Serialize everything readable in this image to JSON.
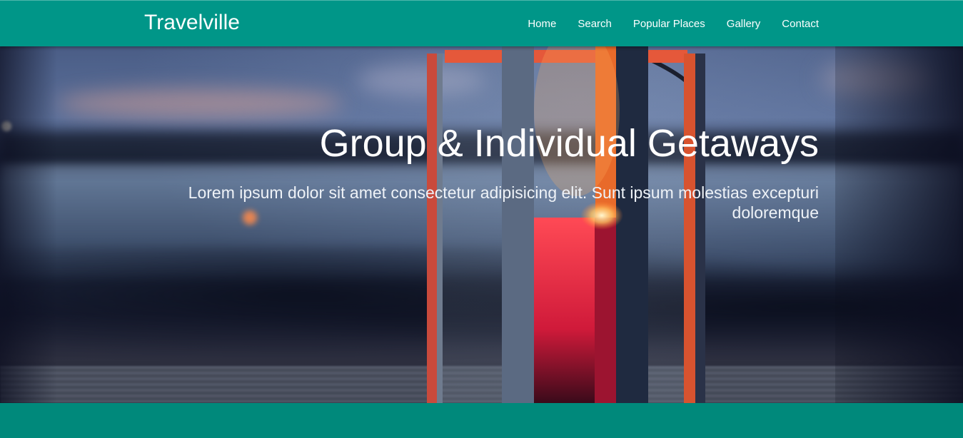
{
  "brand": {
    "name": "Travelville"
  },
  "nav": {
    "items": [
      {
        "label": "Home"
      },
      {
        "label": "Search"
      },
      {
        "label": "Popular Places"
      },
      {
        "label": "Gallery"
      },
      {
        "label": "Contact"
      }
    ]
  },
  "hero": {
    "title": "Group & Individual Getaways",
    "subtitle": "Lorem ipsum dolor sit amet consectetur adipisicing elit. Sunt ipsum molestias excepturi doloremque"
  },
  "colors": {
    "navbar": "#009688",
    "footer": "#00897b",
    "text": "#ffffff"
  }
}
